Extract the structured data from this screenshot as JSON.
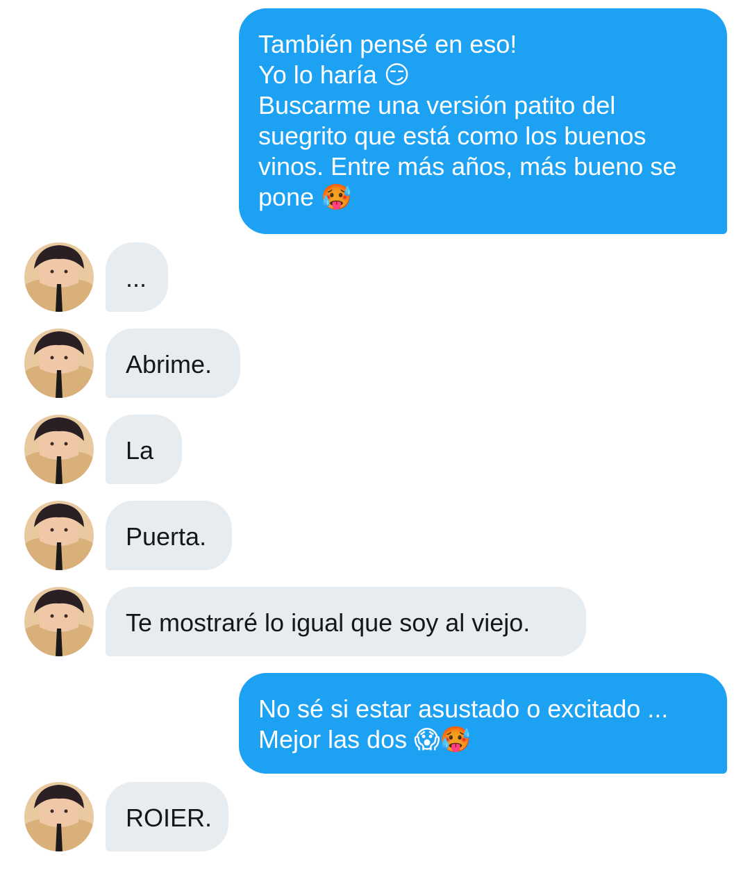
{
  "conversation": {
    "messages": [
      {
        "side": "outgoing",
        "text": "También pensé en eso!\nYo lo haría 😏\nBuscarme una versión patito del suegrito que está como los buenos vinos. Entre más años, más bueno se pone 🥵"
      },
      {
        "side": "incoming",
        "text": "...",
        "avatar_icon": "contact-avatar-icon"
      },
      {
        "side": "incoming",
        "text": "Abrime.",
        "avatar_icon": "contact-avatar-icon"
      },
      {
        "side": "incoming",
        "text": "La",
        "avatar_icon": "contact-avatar-icon"
      },
      {
        "side": "incoming",
        "text": "Puerta.",
        "avatar_icon": "contact-avatar-icon"
      },
      {
        "side": "incoming",
        "text": "Te mostraré lo igual que soy al viejo.",
        "avatar_icon": "contact-avatar-icon"
      },
      {
        "side": "outgoing",
        "text": "No sé si estar asustado o excitado ...\nMejor las dos 😱🥵"
      },
      {
        "side": "incoming",
        "text": "ROIER.",
        "avatar_icon": "contact-avatar-icon"
      }
    ]
  },
  "colors": {
    "outgoing_bubble": "#1da1f2",
    "incoming_bubble": "#e6ecf0",
    "outgoing_text": "#ffffff",
    "incoming_text": "#14171a",
    "background": "#ffffff"
  }
}
